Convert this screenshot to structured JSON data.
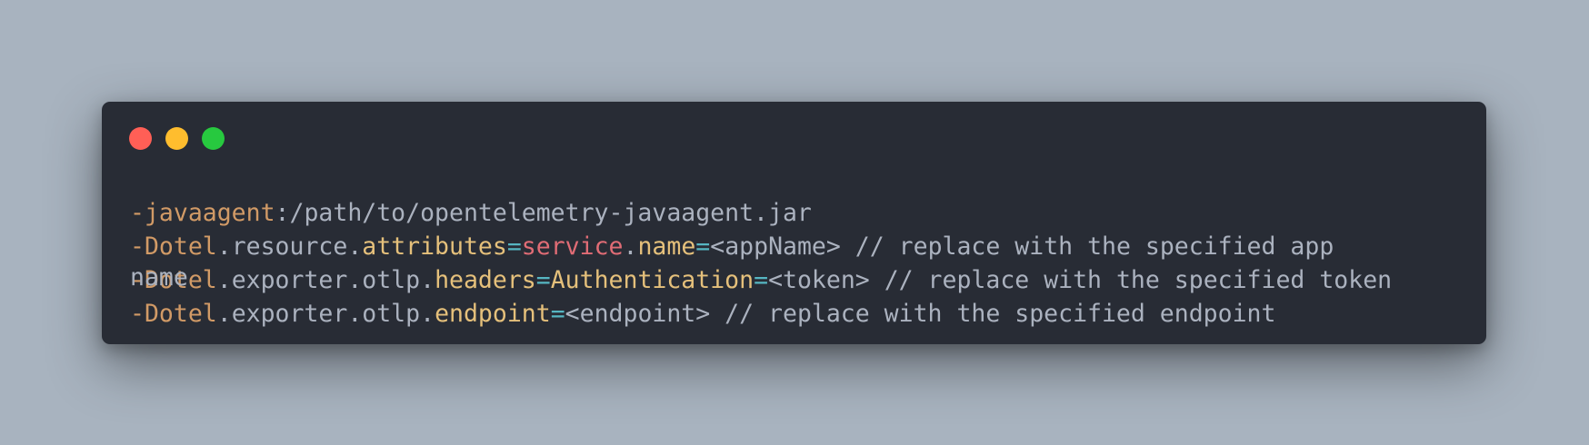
{
  "window": {
    "buttons": [
      {
        "name": "close",
        "color": "#ff5f56"
      },
      {
        "name": "minimize",
        "color": "#ffbd2e"
      },
      {
        "name": "zoom",
        "color": "#27c93f"
      }
    ]
  },
  "colors": {
    "background": "#a8b3bf",
    "window": "#282c35",
    "plain": "#abb2bf",
    "option": "#d19a66",
    "property": "#e5c07b",
    "operator": "#56b6c2",
    "keyword": "#e06c75"
  },
  "code": {
    "lines": [
      [
        {
          "text": "-javaagent",
          "kind": "option"
        },
        {
          "text": ":/path/to/opentelemetry-javaagent.jar",
          "kind": "plain"
        }
      ],
      [
        {
          "text": "-Dotel",
          "kind": "option"
        },
        {
          "text": ".resource.",
          "kind": "plain"
        },
        {
          "text": "attributes",
          "kind": "property"
        },
        {
          "text": "=",
          "kind": "operator"
        },
        {
          "text": "service",
          "kind": "keyword"
        },
        {
          "text": ".",
          "kind": "plain"
        },
        {
          "text": "name",
          "kind": "property"
        },
        {
          "text": "=",
          "kind": "operator"
        },
        {
          "text": "<appName> // replace with the specified app",
          "kind": "plain"
        }
      ],
      [
        {
          "text": "-Dotel",
          "kind": "option"
        },
        {
          "text": ".exporter.otlp.",
          "kind": "plain"
        },
        {
          "text": "headers",
          "kind": "property"
        },
        {
          "text": "=",
          "kind": "operator"
        },
        {
          "text": "Authentication",
          "kind": "property"
        },
        {
          "text": "=",
          "kind": "operator"
        },
        {
          "text": "<token> // replace with the specified token",
          "kind": "plain"
        }
      ],
      [
        {
          "text": "-Dotel",
          "kind": "option"
        },
        {
          "text": ".exporter.otlp.",
          "kind": "plain"
        },
        {
          "text": "endpoint",
          "kind": "property"
        },
        {
          "text": "=",
          "kind": "operator"
        },
        {
          "text": "<endpoint> // replace with the specified endpoint",
          "kind": "plain"
        }
      ]
    ],
    "wrap_tail": "name"
  }
}
